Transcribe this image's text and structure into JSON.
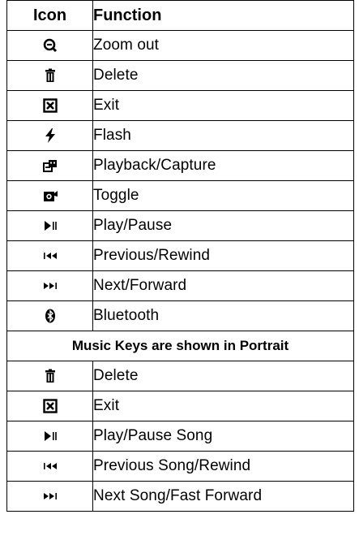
{
  "table": {
    "headers": {
      "icon": "Icon",
      "function": "Function"
    },
    "rows": [
      {
        "icon": "zoom-out-icon",
        "function": "Zoom out"
      },
      {
        "icon": "trash-icon",
        "function": "Delete"
      },
      {
        "icon": "exit-x-box-icon",
        "function": "Exit"
      },
      {
        "icon": "flash-bolt-icon",
        "function": "Flash"
      },
      {
        "icon": "playback-capture-icon",
        "function": "Playback/Capture"
      },
      {
        "icon": "toggle-camera-icon",
        "function": "Toggle"
      },
      {
        "icon": "play-pause-icon",
        "function": "Play/Pause"
      },
      {
        "icon": "previous-rewind-icon",
        "function": "Previous/Rewind"
      },
      {
        "icon": "next-forward-icon",
        "function": "Next/Forward"
      },
      {
        "icon": "bluetooth-icon",
        "function": "Bluetooth"
      }
    ],
    "section_title": "Music Keys are shown in Portrait",
    "music_rows": [
      {
        "icon": "trash-icon",
        "function": "Delete"
      },
      {
        "icon": "exit-x-box-icon",
        "function": "Exit"
      },
      {
        "icon": "play-pause-icon",
        "function": "Play/Pause Song"
      },
      {
        "icon": "previous-rewind-icon",
        "function": "Previous Song/Rewind"
      },
      {
        "icon": "next-forward-icon",
        "function": "Next Song/Fast Forward"
      }
    ]
  }
}
